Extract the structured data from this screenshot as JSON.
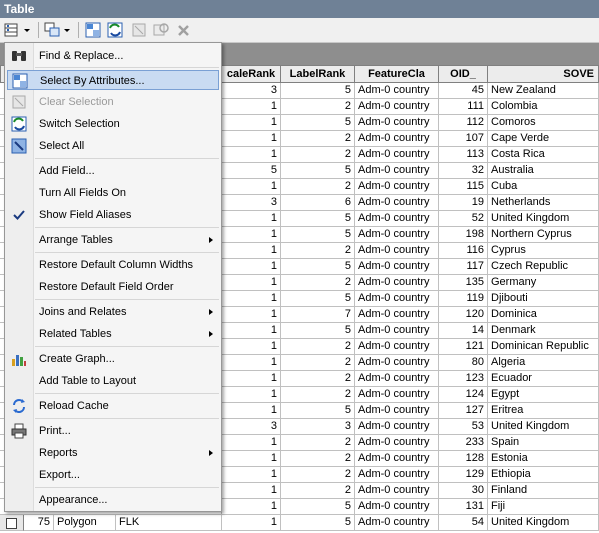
{
  "window": {
    "title": "Table"
  },
  "columns": [
    "caleRank",
    "LabelRank",
    "FeatureCla",
    "OID_",
    "SOVE"
  ],
  "rows": [
    [
      "3",
      "5",
      "Adm-0 country",
      "45",
      "New Zealand"
    ],
    [
      "1",
      "2",
      "Adm-0 country",
      "111",
      "Colombia"
    ],
    [
      "1",
      "5",
      "Adm-0 country",
      "112",
      "Comoros"
    ],
    [
      "1",
      "2",
      "Adm-0 country",
      "107",
      "Cape Verde"
    ],
    [
      "1",
      "2",
      "Adm-0 country",
      "113",
      "Costa Rica"
    ],
    [
      "5",
      "5",
      "Adm-0 country",
      "32",
      "Australia"
    ],
    [
      "1",
      "2",
      "Adm-0 country",
      "115",
      "Cuba"
    ],
    [
      "3",
      "6",
      "Adm-0 country",
      "19",
      "Netherlands"
    ],
    [
      "1",
      "5",
      "Adm-0 country",
      "52",
      "United Kingdom"
    ],
    [
      "1",
      "5",
      "Adm-0 country",
      "198",
      "Northern Cyprus"
    ],
    [
      "1",
      "2",
      "Adm-0 country",
      "116",
      "Cyprus"
    ],
    [
      "1",
      "5",
      "Adm-0 country",
      "117",
      "Czech Republic"
    ],
    [
      "1",
      "2",
      "Adm-0 country",
      "135",
      "Germany"
    ],
    [
      "1",
      "5",
      "Adm-0 country",
      "119",
      "Djibouti"
    ],
    [
      "1",
      "7",
      "Adm-0 country",
      "120",
      "Dominica"
    ],
    [
      "1",
      "5",
      "Adm-0 country",
      "14",
      "Denmark"
    ],
    [
      "1",
      "2",
      "Adm-0 country",
      "121",
      "Dominican Republic"
    ],
    [
      "1",
      "2",
      "Adm-0 country",
      "80",
      "Algeria"
    ],
    [
      "1",
      "2",
      "Adm-0 country",
      "123",
      "Ecuador"
    ],
    [
      "1",
      "2",
      "Adm-0 country",
      "124",
      "Egypt"
    ],
    [
      "1",
      "5",
      "Adm-0 country",
      "127",
      "Eritrea"
    ],
    [
      "3",
      "3",
      "Adm-0 country",
      "53",
      "United Kingdom"
    ],
    [
      "1",
      "2",
      "Adm-0 country",
      "233",
      "Spain"
    ],
    [
      "1",
      "2",
      "Adm-0 country",
      "128",
      "Estonia"
    ],
    [
      "1",
      "2",
      "Adm-0 country",
      "129",
      "Ethiopia"
    ],
    [
      "1",
      "2",
      "Adm-0 country",
      "30",
      "Finland"
    ],
    [
      "1",
      "5",
      "Adm-0 country",
      "131",
      "Fiji"
    ]
  ],
  "last_row": {
    "fid": "75",
    "shape": "Polygon",
    "code": "FLK",
    "rank": "1",
    "label": "5",
    "feature": "Adm-0 country",
    "oid": "54",
    "sov": "United Kingdom"
  },
  "menu": {
    "find_replace": "Find & Replace...",
    "select_by_attributes": "Select By Attributes...",
    "clear_selection": "Clear Selection",
    "switch_selection": "Switch Selection",
    "select_all": "Select All",
    "add_field": "Add Field...",
    "turn_all_fields_on": "Turn All Fields On",
    "show_field_aliases": "Show Field Aliases",
    "arrange_tables": "Arrange Tables",
    "restore_column_widths": "Restore Default Column Widths",
    "restore_field_order": "Restore Default Field Order",
    "joins_relates": "Joins and Relates",
    "related_tables": "Related Tables",
    "create_graph": "Create Graph...",
    "add_table_to_layout": "Add Table to Layout",
    "reload_cache": "Reload Cache",
    "print": "Print...",
    "reports": "Reports",
    "export": "Export...",
    "appearance": "Appearance..."
  },
  "icons": {
    "table_options": "table-options-icon",
    "related_tables": "related-tables-icon",
    "select_by_attributes": "select-by-attributes-icon",
    "switch_selection": "switch-selection-icon",
    "clear_selection": "clear-selection-icon",
    "zoom_to_selected": "zoom-to-selected-icon",
    "delete_selected": "delete-selected-icon"
  },
  "colors": {
    "title_bar": "#6f8196",
    "highlight": "#c9dbf2"
  }
}
